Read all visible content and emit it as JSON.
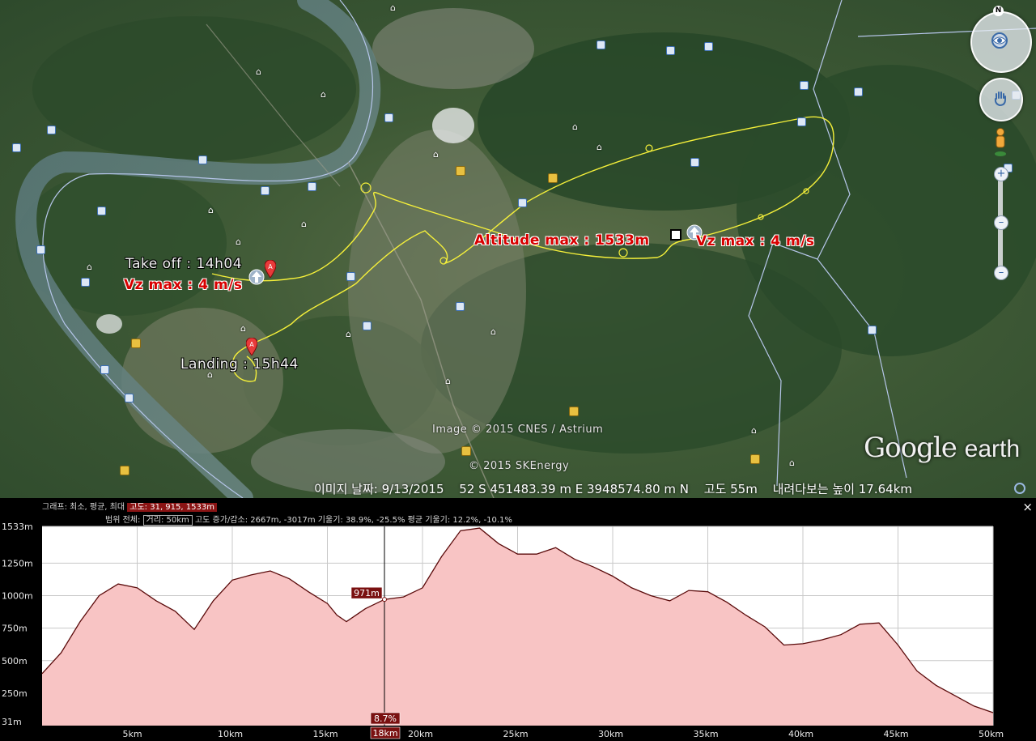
{
  "map": {
    "labels": {
      "takeoff": "Take off : 14h04",
      "vzmax_left": "Vz max : 4 m/s",
      "landing": "Landing : 15h44",
      "altitude_max": "Altitude max : 1533m",
      "vzmax_right": "Vz max : 4 m/s"
    },
    "credits": {
      "image": "Image © 2015 CNES / Astrium",
      "skenergy": "© 2015 SKEnergy"
    },
    "compass_letter": "N",
    "logo": {
      "google": "Google",
      "earth": "earth"
    },
    "status": {
      "date": "이미지 날짜: 9/13/2015",
      "coords": "52 S 451483.39 m E 3948574.80 m N",
      "elev": "고도     55m",
      "eye": "내려다보는 높이   17.64km"
    }
  },
  "profile": {
    "row1_label": "그래프: 최소, 평균, 최대",
    "row1_value": "고도: 31, 915, 1533m",
    "row2_label": "범위 전체:",
    "row2_dist": "거리: 50km",
    "row2_rest": "고도 증가/감소: 2667m, -3017m",
    "row2_slope": "기울기: 38.9%, -25.5%",
    "row2_avg": "평균 기울기: 12.2%, -10.1%",
    "close": "×",
    "cursor_value": "971m",
    "cursor_slope": "8.7%",
    "cursor_km": "18km"
  },
  "chart_data": {
    "type": "area",
    "xlabel": "",
    "ylabel": "",
    "xlim": [
      0,
      50
    ],
    "ylim": [
      0,
      1533
    ],
    "yticks": [
      "31m",
      "250m",
      "500m",
      "750m",
      "1000m",
      "1250m",
      "1533m"
    ],
    "ytick_values": [
      31,
      250,
      500,
      750,
      1000,
      1250,
      1533
    ],
    "xticks": [
      "5km",
      "10km",
      "15km",
      "20km",
      "25km",
      "30km",
      "35km",
      "40km",
      "45km",
      "50km"
    ],
    "xtick_values": [
      5,
      10,
      15,
      20,
      25,
      30,
      35,
      40,
      45,
      50
    ],
    "cursor_x": 18,
    "cursor_y": 971,
    "fill_color": "#f8c4c4",
    "line_color": "#5a0a0a",
    "x": [
      0,
      1,
      2,
      3,
      4,
      5,
      6,
      7,
      8,
      9,
      10,
      11,
      12,
      13,
      14,
      15,
      15.5,
      16,
      16.5,
      17,
      18,
      19,
      20,
      21,
      22,
      23,
      24,
      25,
      26,
      27,
      28,
      29,
      30,
      31,
      32,
      33,
      34,
      35,
      36,
      37,
      38,
      39,
      40,
      41,
      42,
      43,
      44,
      45,
      46,
      47,
      48,
      49,
      50
    ],
    "y": [
      400,
      560,
      800,
      1000,
      1090,
      1060,
      960,
      880,
      740,
      960,
      1120,
      1160,
      1190,
      1130,
      1030,
      940,
      850,
      800,
      850,
      900,
      971,
      990,
      1060,
      1300,
      1500,
      1520,
      1400,
      1320,
      1320,
      1370,
      1280,
      1220,
      1150,
      1060,
      1000,
      960,
      1040,
      1030,
      950,
      850,
      760,
      620,
      630,
      660,
      700,
      780,
      790,
      620,
      420,
      310,
      230,
      150,
      100
    ]
  }
}
